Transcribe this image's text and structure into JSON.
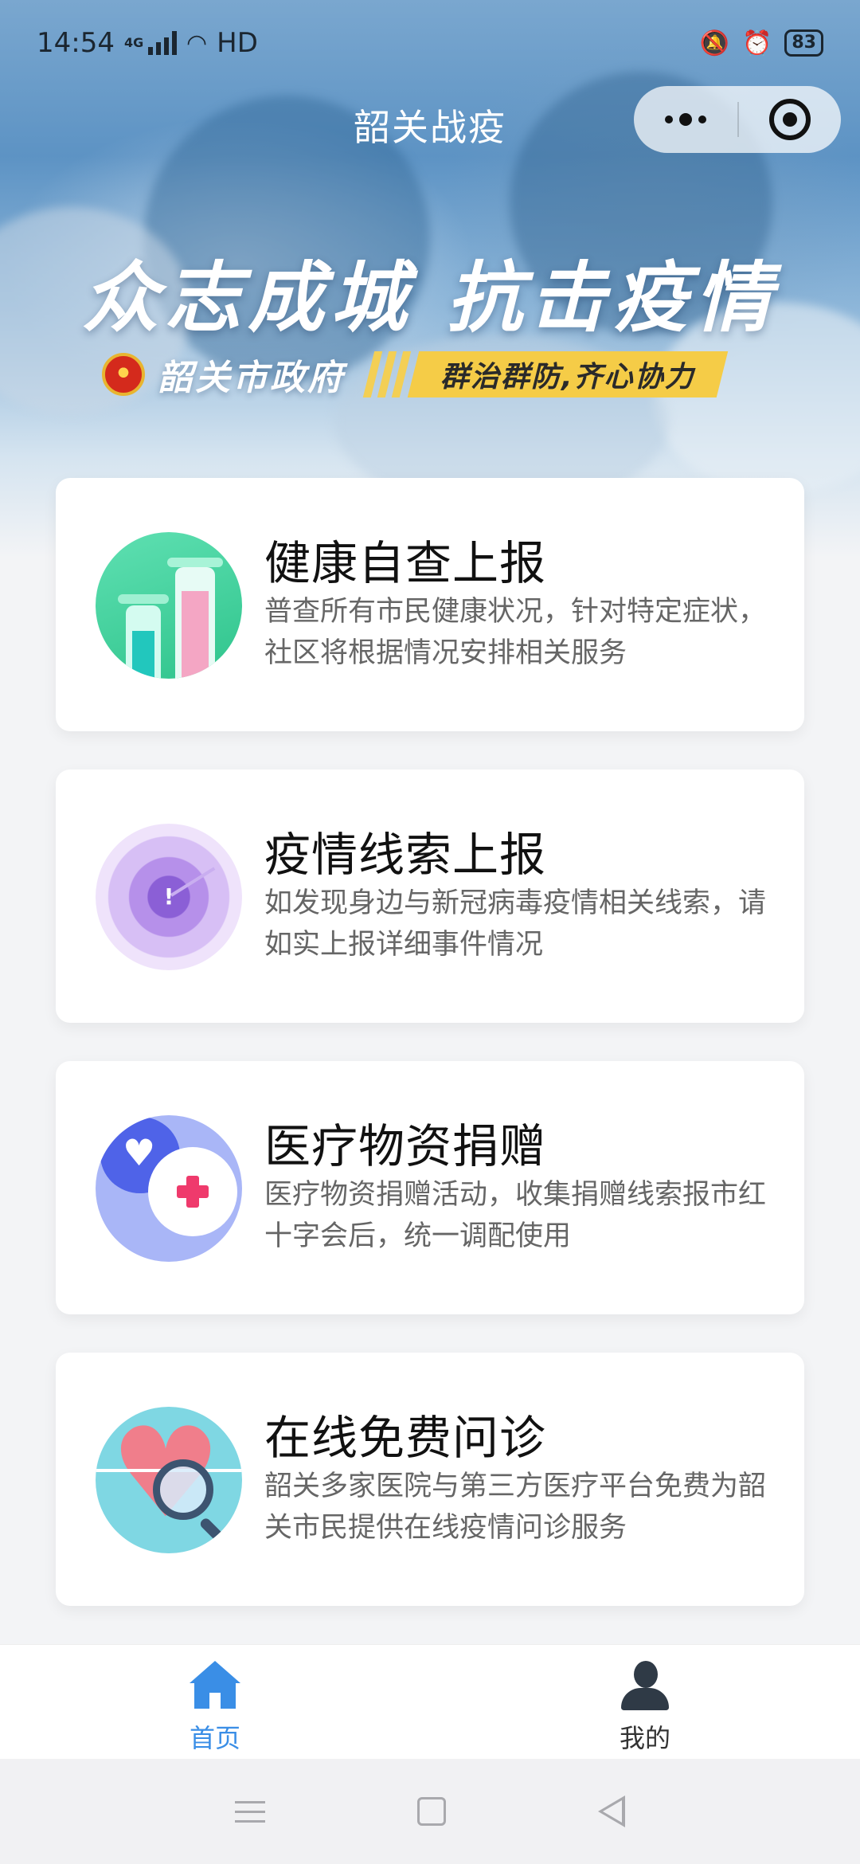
{
  "status_bar": {
    "time": "14:54",
    "network": "4G",
    "hd": "HD",
    "battery": "83"
  },
  "nav": {
    "title": "韶关战疫"
  },
  "banner": {
    "slogan": "众志成城 抗击疫情",
    "government": "韶关市政府",
    "tagline": "群治群防,齐心协力"
  },
  "cards": [
    {
      "title": "健康自查上报",
      "desc": "普查所有市民健康状况，针对特定症状，社区将根据情况安排相关服务",
      "icon": "test-tubes-icon"
    },
    {
      "title": "疫情线索上报",
      "desc": "如发现身边与新冠病毒疫情相关线索，请如实上报详细事件情况",
      "icon": "radar-alert-icon"
    },
    {
      "title": "医疗物资捐赠",
      "desc": "医疗物资捐赠活动，收集捐赠线索报市红十字会后，统一调配使用",
      "icon": "donation-chat-icon"
    },
    {
      "title": "在线免费问诊",
      "desc": "韶关多家医院与第三方医疗平台免费为韶关市民提供在线疫情问诊服务",
      "icon": "heart-magnifier-icon"
    }
  ],
  "tabbar": {
    "home_label": "首页",
    "mine_label": "我的",
    "active": "home",
    "accent_color": "#3a8ee6"
  }
}
